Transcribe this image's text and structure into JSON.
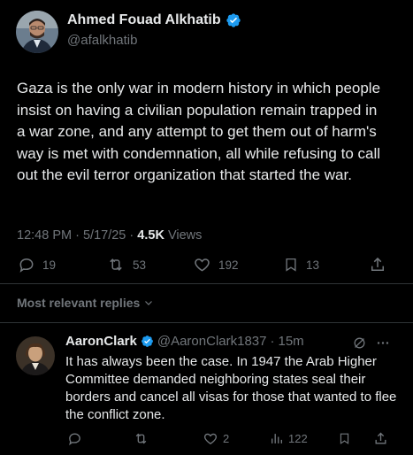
{
  "post": {
    "author_name": "Ahmed Fouad Alkhatib",
    "author_handle": "@afalkhatib",
    "text": "Gaza is the only war in modern history in which people insist on having a civilian population remain trapped in a war zone, and any attempt to get them out of harm's way is met with condemnation, all while refusing to call out the evil terror organization that started the war.",
    "time": "12:48 PM",
    "separator": "·",
    "date": "5/17/25",
    "views_count": "4.5K",
    "views_label": "Views",
    "replies": "19",
    "reposts": "53",
    "likes": "192",
    "bookmarks": "13"
  },
  "replies_section": {
    "label": "Most relevant replies"
  },
  "reply": {
    "name": "AaronClark",
    "handle": "@AaronClark1837",
    "separator": "·",
    "time": "15m",
    "text": "It has always been the case. In 1947 the Arab Higher Committee demanded neighboring states seal their borders and cancel all visas for those that wanted to flee the conflict zone.",
    "likes": "2",
    "views": "122"
  },
  "colors": {
    "background": "#000000",
    "text_primary": "#e7e9ea",
    "text_secondary": "#71767b",
    "verified_blue": "#1d9bf0",
    "divider": "#2f3336"
  },
  "icons": {
    "reply": "reply-icon",
    "repost": "repost-icon",
    "like": "heart-icon",
    "bookmark": "bookmark-icon",
    "share": "share-icon",
    "views": "views-icon",
    "grok": "grok-icon",
    "more": "more-icon"
  }
}
